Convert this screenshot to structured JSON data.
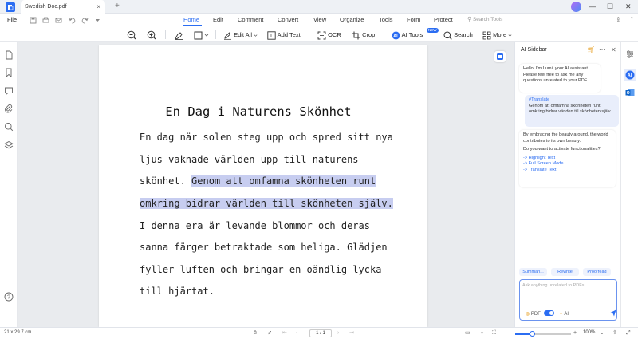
{
  "window": {
    "tab_title": "Swedish Doc.pdf",
    "tab_close": "×",
    "new_tab": "+",
    "controls": {
      "minimize": "—",
      "maximize": "☐",
      "close": "✕"
    }
  },
  "menu": {
    "file": "File",
    "tabs": [
      "Home",
      "Edit",
      "Comment",
      "Convert",
      "View",
      "Organize",
      "Tools",
      "Form",
      "Protect"
    ],
    "active_tab": "Home",
    "search_placeholder": "Search Tools"
  },
  "toolbar": {
    "edit_all": "Edit All",
    "add_text": "Add Text",
    "ocr": "OCR",
    "crop": "Crop",
    "ai_tools": "AI Tools",
    "ai_tools_badge": "NEW",
    "search": "Search",
    "more": "More"
  },
  "document": {
    "title": "En Dag i Naturens Skönhet",
    "lines": [
      "En dag när solen steg upp och spred sitt nya",
      "ljus vaknade världen upp till naturens",
      "skönhet. ",
      "omkring bidrar världen till skönheten själv.",
      "I denna era är levande blommor och deras",
      "sanna färger betraktade som heliga. Glädjen",
      "fyller luften och bringar en oändlig lycka",
      "till hjärtat."
    ],
    "highlight_line3": "Genom att omfamna skönheten runt"
  },
  "ai_sidebar": {
    "title": "AI Sidebar",
    "greeting": "Hello, I'm Lumi, your AI assistant. Please feel free to ask me any questions unrelated to your PDF.",
    "user_tag": "#Translate",
    "user_text": "Genom att omfamna skönheten runt omkring bidrar världen till skönheten själv.",
    "reply": "By embracing the beauty around, the world contributes to its own beauty.",
    "question": "Do you want to activate functionalities?",
    "links": [
      "-> Highlight Text",
      "-> Full Screen Mode",
      "-> Translate Text"
    ],
    "chips": [
      "Summari...",
      "Rewrite",
      "Proofread"
    ],
    "input_placeholder": "Ask anything unrelated to PDFs",
    "pdf_label": "PDF",
    "ai_label": "AI"
  },
  "status": {
    "page_size": "21 x 29.7 cm",
    "page_number": "1 / 1",
    "zoom": "100%",
    "zoom_level": 0.3
  },
  "colors": {
    "accent": "#2b6df2",
    "highlight": "#c7cdf0",
    "canvas": "#e9ebee"
  }
}
